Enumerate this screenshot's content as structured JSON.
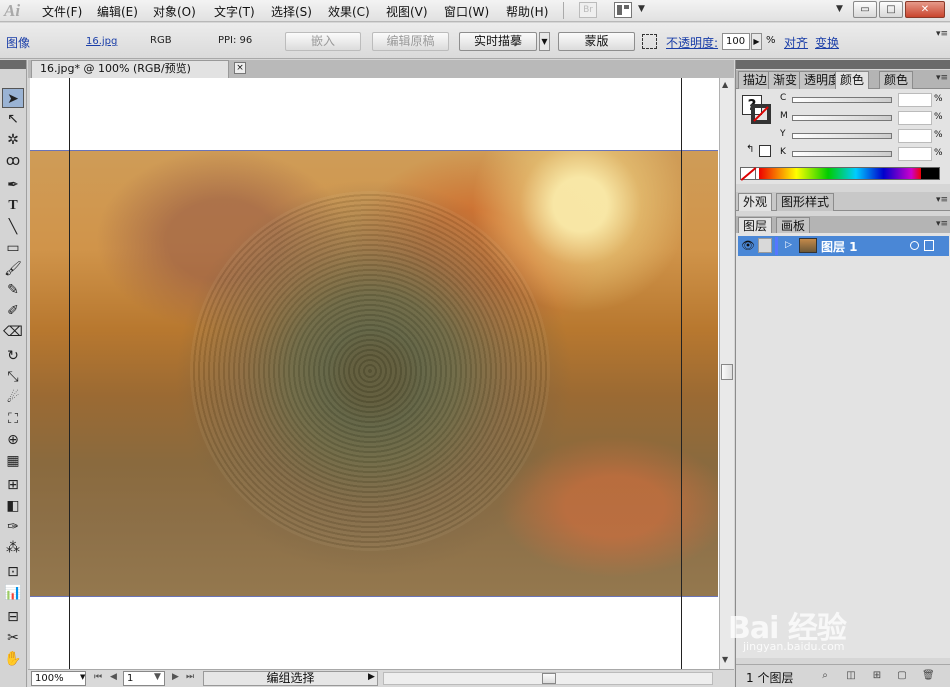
{
  "menubar": {
    "logo": "Ai",
    "items": [
      "文件(F)",
      "编辑(E)",
      "对象(O)",
      "文字(T)",
      "选择(S)",
      "效果(C)",
      "视图(V)",
      "窗口(W)",
      "帮助(H)"
    ],
    "br_label": "Br"
  },
  "control_bar": {
    "type_label": "图像",
    "filename": "16.jpg",
    "color_mode": "RGB",
    "ppi": "PPI: 96",
    "embed_button": "嵌入",
    "edit_original_button": "编辑原稿",
    "live_trace_button": "实时描摹",
    "mask_button": "蒙版",
    "opacity_label": "不透明度:",
    "opacity_value": "100",
    "opacity_unit": "%",
    "align_link": "对齐",
    "transform_link": "变换"
  },
  "document": {
    "tab_title": "16.jpg* @ 100% (RGB/预览)",
    "close_glyph": "×"
  },
  "statusbar": {
    "zoom": "100%",
    "page": "1",
    "status": "编组选择"
  },
  "panels": {
    "top_tabs": [
      "描边",
      "渐变",
      "透明度",
      "颜色",
      "颜色"
    ],
    "cmyk": [
      {
        "label": "C",
        "unit": "%"
      },
      {
        "label": "M",
        "unit": "%"
      },
      {
        "label": "Y",
        "unit": "%"
      },
      {
        "label": "K",
        "unit": "%"
      }
    ],
    "appearance_tabs": [
      "外观",
      "图形样式"
    ],
    "layer_tabs": [
      "图层",
      "画板"
    ],
    "layers": [
      {
        "name": "图层 1"
      }
    ],
    "footer_text": "1 个图层"
  },
  "watermark": {
    "brand": "Bai 经验",
    "url": "jingyan.baidu.com"
  },
  "colors": {
    "selection_blue": "#4a87d6",
    "link_blue": "#1a3ea8",
    "close_red": "#c9452e"
  }
}
